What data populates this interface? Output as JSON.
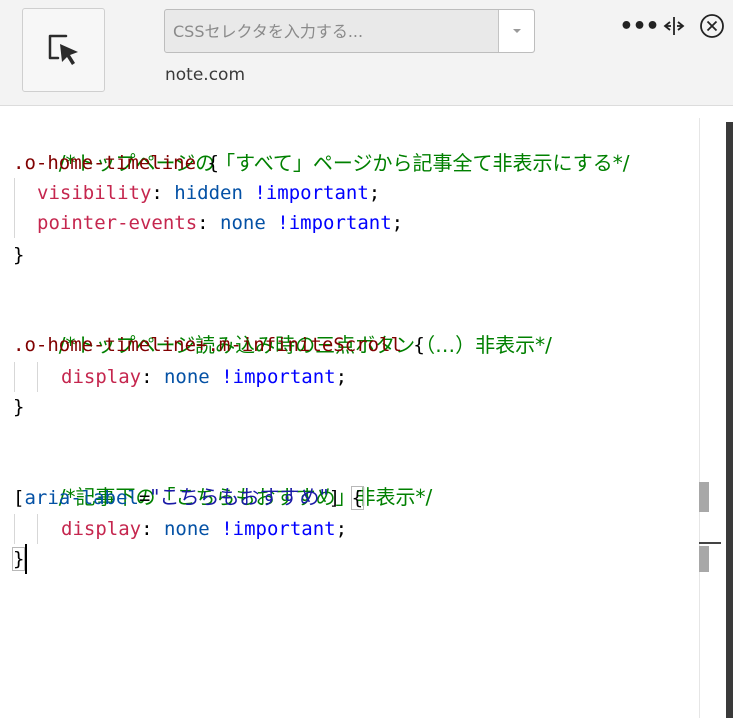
{
  "toolbar": {
    "picker_icon": "element-picker-icon",
    "selector_placeholder": "CSSセレクタを入力する...",
    "selector_value": "",
    "site": "note.com",
    "more_label": "•••"
  },
  "editor": {
    "lines": [
      {
        "comment": "/*トップページの「すべて」ページから記事全て非表示にする*/"
      },
      {
        "selector": ".o-home-timeline",
        "open": " {"
      },
      {
        "prop": "visibility",
        "value": "hidden",
        "important": "!important"
      },
      {
        "prop": "pointer-events",
        "value": "none",
        "important": "!important"
      },
      {
        "close": "}"
      },
      {
        "comment": "/*トップページ読み込み時の三点ボタン（…）非表示*/"
      },
      {
        "selector": ".o-home-timeline+.m-infiniteScroll",
        "open": " {"
      },
      {
        "prop": "display",
        "value": "none",
        "important": "!important"
      },
      {
        "close": "}"
      },
      {
        "comment": "/*記事下の「こちらもおすすめ」非表示*/"
      },
      {
        "attr_open": "[",
        "attr_name": "aria-label",
        "attr_eq": "=",
        "attr_value": "\"こちらもおすすめ\"",
        "attr_close": "]",
        "open": "{"
      },
      {
        "prop": "display",
        "value": "none",
        "important": "!important"
      },
      {
        "close": "}"
      }
    ]
  }
}
